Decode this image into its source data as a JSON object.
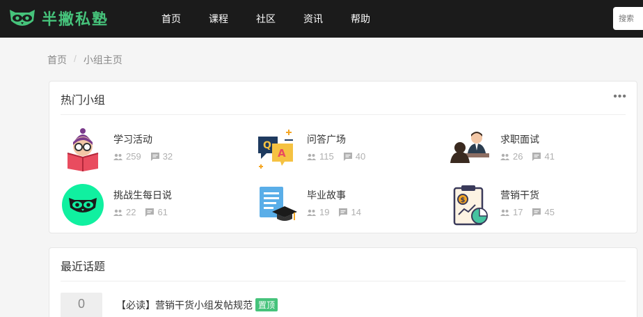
{
  "header": {
    "brand": "半撇私塾",
    "nav": [
      "首页",
      "课程",
      "社区",
      "资讯",
      "帮助"
    ],
    "search_placeholder": "搜索"
  },
  "breadcrumb": {
    "home": "首页",
    "sep": "/",
    "current": "小组主页"
  },
  "hot_groups": {
    "title": "热门小组",
    "more": "•••",
    "groups": [
      {
        "name": "学习活动",
        "members": "259",
        "posts": "32",
        "icon": "student-reading-icon"
      },
      {
        "name": "问答广场",
        "members": "115",
        "posts": "40",
        "icon": "qa-bubbles-icon"
      },
      {
        "name": "求职面试",
        "members": "26",
        "posts": "41",
        "icon": "interview-icon"
      },
      {
        "name": "挑战生每日说",
        "members": "22",
        "posts": "61",
        "icon": "owl-logo-icon"
      },
      {
        "name": "毕业故事",
        "members": "19",
        "posts": "14",
        "icon": "graduation-doc-icon"
      },
      {
        "name": "营销干货",
        "members": "17",
        "posts": "45",
        "icon": "marketing-clipboard-icon"
      }
    ]
  },
  "recent_topics": {
    "title": "最近话题",
    "topics": [
      {
        "votes": "0",
        "title": "【必读】营销干货小组发帖规范",
        "badge": "置顶"
      }
    ]
  },
  "colors": {
    "brand": "#46c37b",
    "topbar": "#1b1b1b",
    "owl_bg": "#10f0a0"
  }
}
